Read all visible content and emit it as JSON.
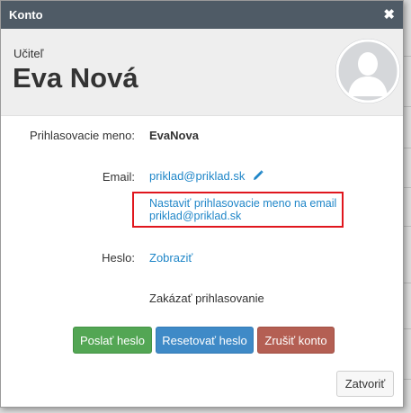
{
  "dialog": {
    "title": "Konto",
    "close_glyph": "✖"
  },
  "header": {
    "role": "Učiteľ",
    "name": "Eva Nová",
    "avatar_icon": "user-silhouette-icon"
  },
  "fields": {
    "login_label": "Prihlasovacie meno:",
    "login_value": "EvaNova",
    "email_label": "Email:",
    "email_value": "priklad@priklad.sk",
    "email_edit_icon": "pencil-icon",
    "email_suggestion_line1": "Nastaviť prihlasovacie meno na email",
    "email_suggestion_line2": "priklad@priklad.sk",
    "password_label": "Heslo:",
    "password_action": "Zobraziť",
    "disable_login": "Zakázať prihlasovanie"
  },
  "buttons": {
    "send_password": "Poslať heslo",
    "reset_password": "Resetovať heslo",
    "cancel_account": "Zrušiť konto",
    "close": "Zatvoriť"
  },
  "colors": {
    "titlebar": "#4f5b66",
    "link": "#1f86c8",
    "highlight_border": "#e0161d",
    "green_button": "#53a654",
    "blue_button": "#3f8ac7",
    "red_button": "#b45f53"
  }
}
